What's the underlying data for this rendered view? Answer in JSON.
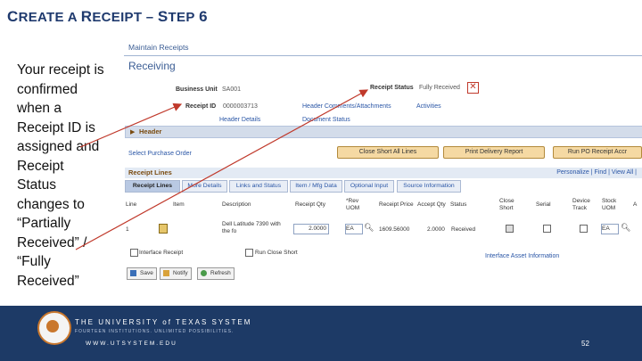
{
  "slide": {
    "title_prefix_c": "C",
    "title_rest1": "REATE A ",
    "title_prefix_r": "R",
    "title_rest2": "ECEIPT – ",
    "title_prefix_s": "S",
    "title_rest3": "TEP",
    "title_num": "6",
    "caption": "Your receipt is confirmed when a Receipt ID is assigned and Receipt Status changes to “Partially Received” / “Fully Received”",
    "footer_org": "THE UNIVERSITY of TEXAS SYSTEM",
    "footer_tagline": "FOURTEEN INSTITUTIONS. UNLIMITED POSSIBILITIES.",
    "footer_url": "WWW.UTSYSTEM.EDU",
    "page_number": "52"
  },
  "app": {
    "breadcrumb": "Maintain Receipts",
    "page_title": "Receiving",
    "business_unit_label": "Business Unit",
    "business_unit_value": "SA001",
    "receipt_id_label": "Receipt ID",
    "receipt_id_value": "0000003713",
    "receipt_status_label": "Receipt Status",
    "receipt_status_value": "Fully Received",
    "header_comments_link": "Header Comments/Attachments",
    "activities_link": "Activities",
    "header_details_link": "Header Details",
    "document_status_link": "Document Status",
    "header_section": "Header",
    "select_po_link": "Select Purchase Order",
    "buttons": {
      "close_short_all": "Close Short All Lines",
      "print_delivery": "Print Delivery Report",
      "run_po_receipt": "Run PO Receipt Accr"
    },
    "receipt_lines_title": "Receipt Lines",
    "grid_nav": "Personalize | Find | View All |",
    "tabs": [
      "Receipt Lines",
      "More Details",
      "Links and Status",
      "Item / Mfg Data",
      "Optional Input",
      "Source Information"
    ],
    "columns": [
      "Line",
      "Item",
      "Description",
      "Receipt Qty",
      "*Rev UOM",
      "Receipt Price",
      "Accept Qty",
      "Status",
      "Close Short",
      "Serial",
      "Device Track",
      "Stock UOM",
      "A"
    ],
    "row": {
      "line": "1",
      "description": "Dell Latitude 7390 with the fo",
      "receipt_qty": "2.0000",
      "rev_uom": "EA",
      "receipt_price": "1609.56000",
      "accept_qty": "2.0000",
      "status": "Received",
      "stock_uom": "EA"
    },
    "interface_receipt": "Interface Receipt",
    "run_close_short": "Run Close Short",
    "interface_asset_link": "Interface Asset Information",
    "save": "Save",
    "notify": "Notify",
    "refresh": "Refresh"
  },
  "colors": {
    "title": "#1f3a6e",
    "footer": "#1d3a66",
    "arrow": "#c0392b",
    "link": "#2a56a6"
  }
}
